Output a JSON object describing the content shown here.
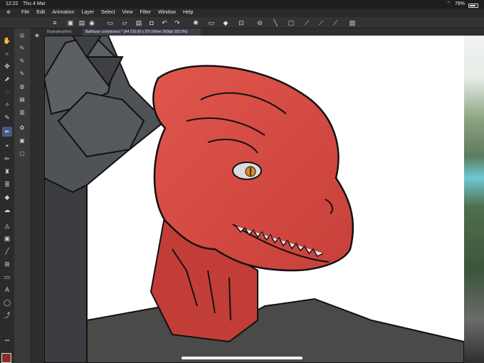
{
  "status": {
    "time": "12:22",
    "date": "Thu 4 Mar",
    "battery": "78%",
    "battery_level": 0.78
  },
  "menu": [
    "File",
    "Edit",
    "Animation",
    "Layer",
    "Select",
    "View",
    "Filter",
    "Window",
    "Help"
  ],
  "tabs": [
    {
      "label": "Illustration(Reci"
    },
    {
      "label": "Balthazar commission * (A4 210.00 x 297.00mm 350dpi 252.0%)"
    }
  ],
  "icons": {
    "command_bar": [
      "hamburger-icon",
      "new-file-icon",
      "open-icon",
      "save-icon",
      "copy-icon",
      "import-icon",
      "export-icon",
      "camera-icon",
      "undo-icon",
      "redo-icon",
      "clear-icon",
      "fill-icon",
      "select-all-icon",
      "deselect-icon",
      "transform-icon",
      "show-ruler-icon",
      "snap-ruler-icon",
      "snap-guide-icon",
      "snap-grid-icon",
      "settings-icon"
    ],
    "tools": [
      "hand-icon",
      "zoom-icon",
      "move-icon",
      "operation-icon",
      "lasso-icon",
      "magic-wand-icon",
      "eyedropper-icon",
      "pen-icon",
      "eraser-icon",
      "pencil-icon",
      "brush-icon",
      "airbrush-icon",
      "decoration-icon",
      "blend-icon",
      "fill-icon",
      "gradient-icon",
      "figure-icon",
      "frame-icon",
      "ruler-icon",
      "text-icon",
      "balloon-icon",
      "correct-line-icon"
    ],
    "subtools": [
      "pen-subtool-icon",
      "marker-subtool-icon",
      "gpen-subtool-icon",
      "turnip-pen-icon",
      "milli-pen-icon",
      "layer-icon",
      "decoration-subtool-icon",
      "texture-icon",
      "material-icon",
      "folder-icon",
      "image-icon"
    ]
  },
  "colors": {
    "main": "#8a2f2a",
    "accent": "#4a5a86",
    "artwork_red": "#d95047"
  }
}
